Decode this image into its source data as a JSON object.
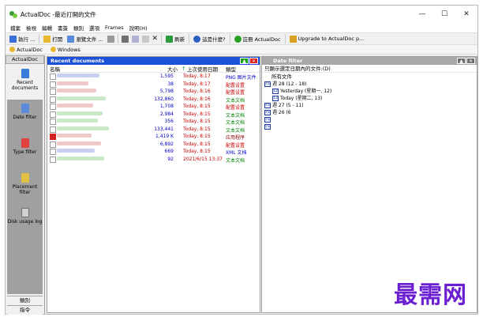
{
  "window": {
    "title": "ActualDoc -最近打開的文件"
  },
  "menu": [
    "檔案",
    "檢視",
    "編輯",
    "書簽",
    "類別",
    "選項",
    "Frames",
    "說明(H)"
  ],
  "toolbar": {
    "execute": "執行 ...",
    "open": "打開",
    "browse": "瀏覽文件 ...",
    "refresh": "刷新",
    "whats_this": "這是什麼?",
    "register": "註冊 ActualDoc",
    "upgrade": "Upgrade to ActualDoc p..."
  },
  "favorites": [
    "ActualDoc",
    "Windows"
  ],
  "sidebar": {
    "header": "ActualDoc",
    "items": [
      {
        "label": "Recent documents",
        "icon": "recent-documents-icon",
        "active": true
      },
      {
        "label": "Date filter",
        "icon": "calendar-icon"
      },
      {
        "label": "Type filter",
        "icon": "type-filter-icon"
      },
      {
        "label": "Placement filter",
        "icon": "placement-filter-icon"
      },
      {
        "label": "Disk usage log",
        "icon": "disk-usage-icon"
      }
    ],
    "bottom": [
      "類別",
      "指令"
    ]
  },
  "recent": {
    "title": "Recent documents",
    "columns": {
      "name": "名稱",
      "size": "大小",
      "date": "上次使用日期",
      "type": "類型"
    },
    "rows": [
      {
        "size": "1,595",
        "date": "Today, 8:17",
        "type": "PNG 图片文件",
        "color": "#0000c8"
      },
      {
        "size": "38",
        "date": "Today, 8:17",
        "type": "配置设置",
        "color": "#c80000"
      },
      {
        "size": "5,798",
        "date": "Today, 8:16",
        "type": "配置设置",
        "color": "#c80000"
      },
      {
        "size": "132,860",
        "date": "Today, 8:16",
        "type": "文本文档",
        "color": "#008000"
      },
      {
        "size": "1,708",
        "date": "Today, 8:15",
        "type": "配置设置",
        "color": "#c80000"
      },
      {
        "size": "2,984",
        "date": "Today, 8:15",
        "type": "文本文档",
        "color": "#008000"
      },
      {
        "size": "356",
        "date": "Today, 8:15",
        "type": "文本文档",
        "color": "#008000"
      },
      {
        "size": "133,441",
        "date": "Today, 8:15",
        "type": "文本文档",
        "color": "#008000"
      },
      {
        "size": "1,419 K",
        "date": "Today, 8:15",
        "type": "应用程序",
        "color": "#800000"
      },
      {
        "size": "6,892",
        "date": "Today, 8:15",
        "type": "配置设置",
        "color": "#c80000"
      },
      {
        "size": "669",
        "date": "Today, 8:15",
        "type": "XML 文档",
        "color": "#0000c8"
      },
      {
        "size": "92",
        "date": "2021/6/15 13:37",
        "type": "文本文档",
        "color": "#008000"
      }
    ]
  },
  "date_filter": {
    "title": "Date filter",
    "subtitle": "只顯示選定日期內的文件:(D)",
    "all": "所有文件",
    "items": [
      {
        "text": "週 28 (12 - 18)",
        "level": 0,
        "badge": "FS"
      },
      {
        "text": "Yesterday (星期一, 12)",
        "level": 1,
        "badge": "12"
      },
      {
        "text": "Today (星期二, 13)",
        "level": 1,
        "badge": "13"
      },
      {
        "text": "週 27 (5 - 11)",
        "level": 0,
        "badge": "FS"
      },
      {
        "text": "週 26 (6",
        "level": 0,
        "badge": "FS"
      },
      {
        "text": "",
        "level": 0,
        "badge": "FS"
      },
      {
        "text": "",
        "level": 0,
        "badge": "FS"
      }
    ]
  },
  "watermark": "最需网",
  "colors": {
    "pane_header_active": "#1c50d8",
    "pane_header_inactive": "#a8a8a8",
    "date_text": "#c80000",
    "size_text": "#0000c8",
    "button_green": "#1ea01e",
    "button_red": "#e02020",
    "watermark": "#6a1fd0"
  }
}
